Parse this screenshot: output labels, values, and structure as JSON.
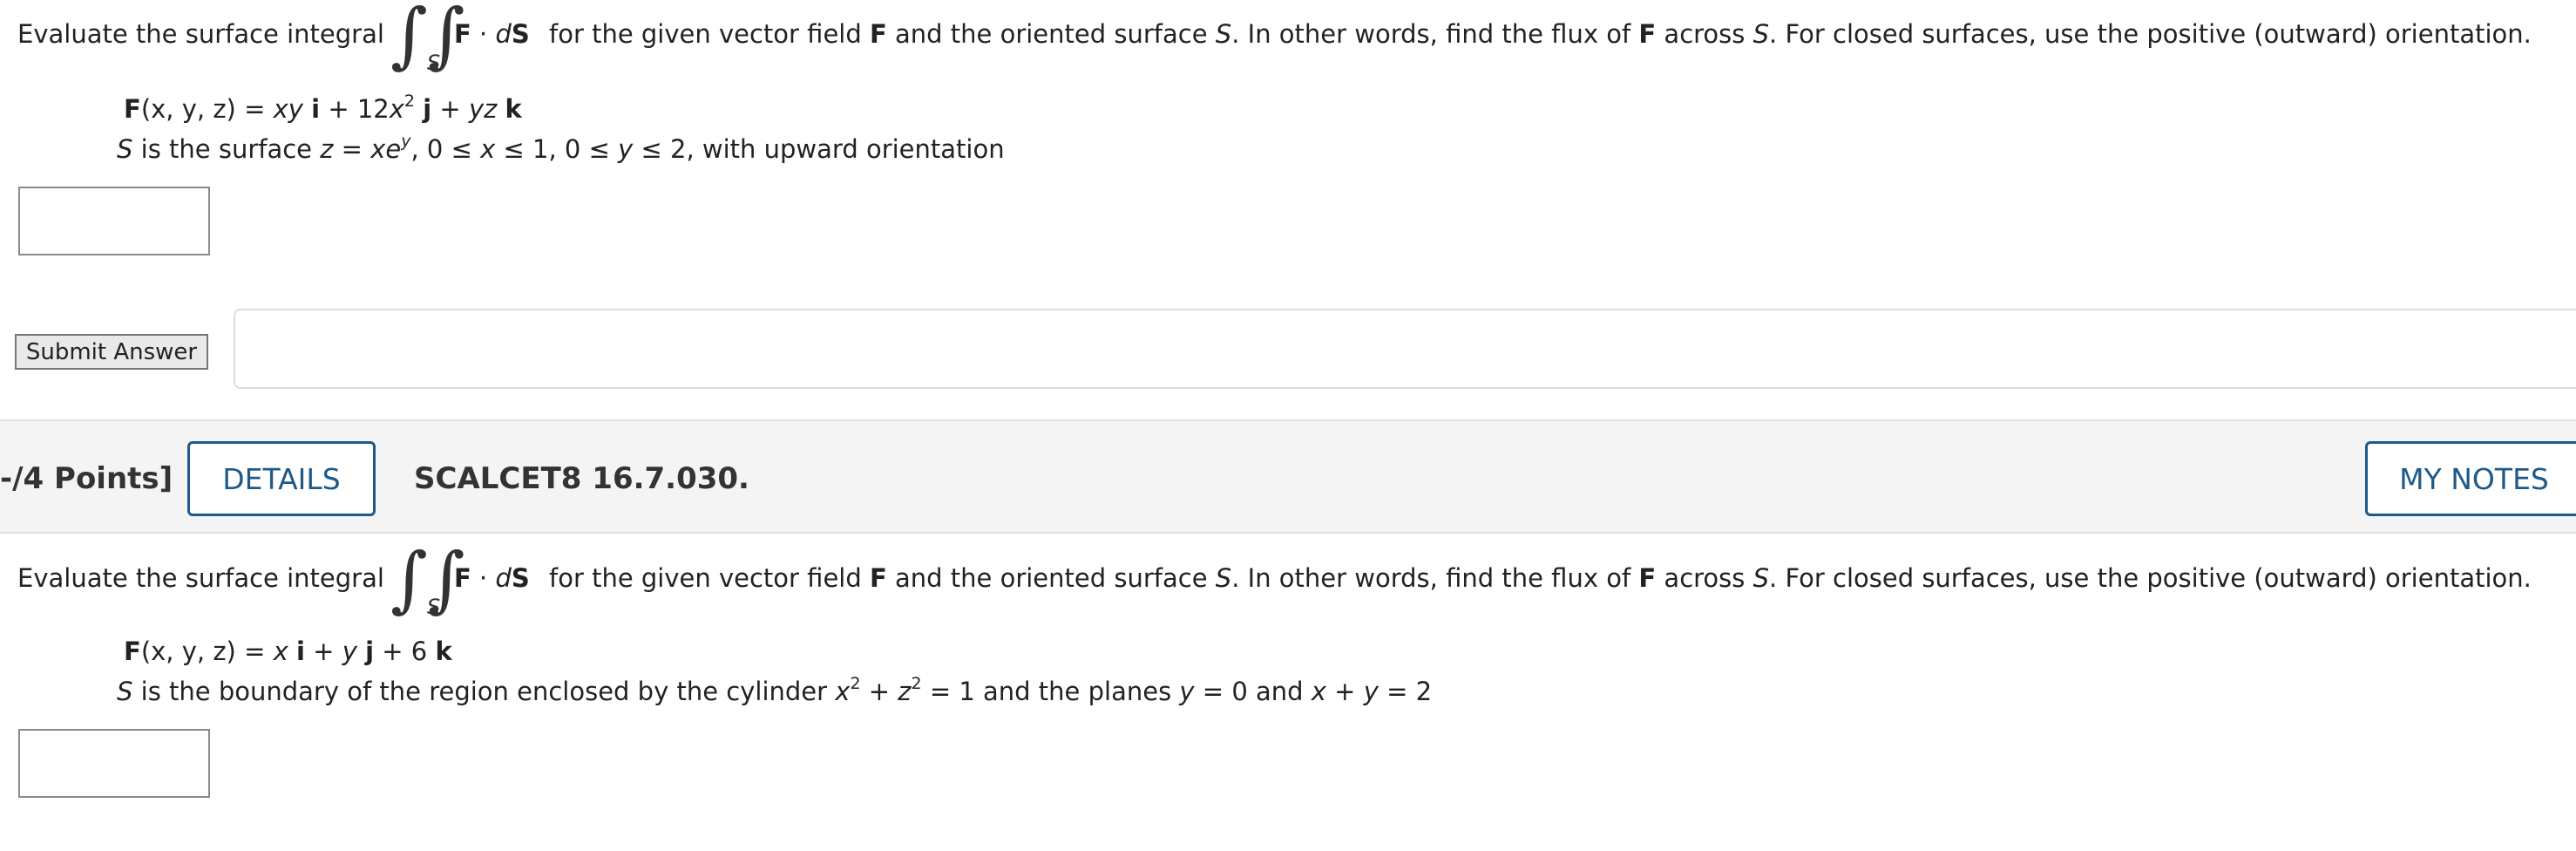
{
  "question1": {
    "intro": "Evaluate the surface integral",
    "integrand_F": "F",
    "integrand_dot": " · ",
    "integrand_d": "d",
    "integrand_S": "S",
    "integral_subscript": "S",
    "instructions_a": "for the given vector field",
    "instructions_F": "F",
    "instructions_b": "and the oriented surface",
    "instructions_S": "S",
    "instructions_c": ". In other words, find the flux of",
    "instructions_F2": "F",
    "instructions_d": "across",
    "instructions_S2": "S",
    "instructions_e": ". For closed surfaces, use the positive (outward) orientation.",
    "field": {
      "F": "F",
      "args": "(x, y, z) = ",
      "t1": "xy",
      "i": "i",
      "plus1": " + 12",
      "x": "x",
      "exp": "2",
      "j": "j",
      "plus2": " + ",
      "t3": "yz",
      "k": "k"
    },
    "surface": {
      "S": "S",
      "a": " is the surface ",
      "z": "z",
      "eq": " = ",
      "x": "x",
      "e": "e",
      "ey": "y",
      "rest": ", 0 ≤ ",
      "x2": "x",
      "mid": " ≤ 1, 0 ≤ ",
      "y": "y",
      "end": " ≤ 2,  with upward orientation"
    },
    "answer_value": ""
  },
  "submit_label": "Submit Answer",
  "question2_header": {
    "points": "-/4 Points]",
    "details_label": "DETAILS",
    "code": "SCALCET8 16.7.030.",
    "my_notes_label": "MY NOTES"
  },
  "question2": {
    "intro": "Evaluate the surface integral",
    "integrand_F": "F",
    "integrand_dot": " · ",
    "integrand_d": "d",
    "integrand_S": "S",
    "integral_subscript": "S",
    "instructions_a": "for the given vector field",
    "instructions_F": "F",
    "instructions_b": "and the oriented surface",
    "instructions_S": "S",
    "instructions_c": ". In other words, find the flux of",
    "instructions_F2": "F",
    "instructions_d": "across",
    "instructions_S2": "S",
    "instructions_e": ". For closed surfaces, use the positive (outward) orientation.",
    "field": {
      "F": "F",
      "args": "(x, y, z) = ",
      "x": "x",
      "i": "i",
      "plus1": " + ",
      "y": "y",
      "j": "j",
      "plus2": " + 6 ",
      "k": "k"
    },
    "surface": {
      "S": "S",
      "a": " is the boundary of the region enclosed by the cylinder  ",
      "x": "x",
      "xexp": "2",
      "plus": " + ",
      "z": "z",
      "zexp": "2",
      "b": " = 1  and the planes  ",
      "y": "y",
      "c": " = 0 and ",
      "x2": "x",
      "plus2": " + ",
      "y2": "y",
      "d": " = 2"
    },
    "answer_value": ""
  },
  "colors": {
    "accent": "#1d5a8a",
    "header_bg": "#f4f4f4"
  }
}
